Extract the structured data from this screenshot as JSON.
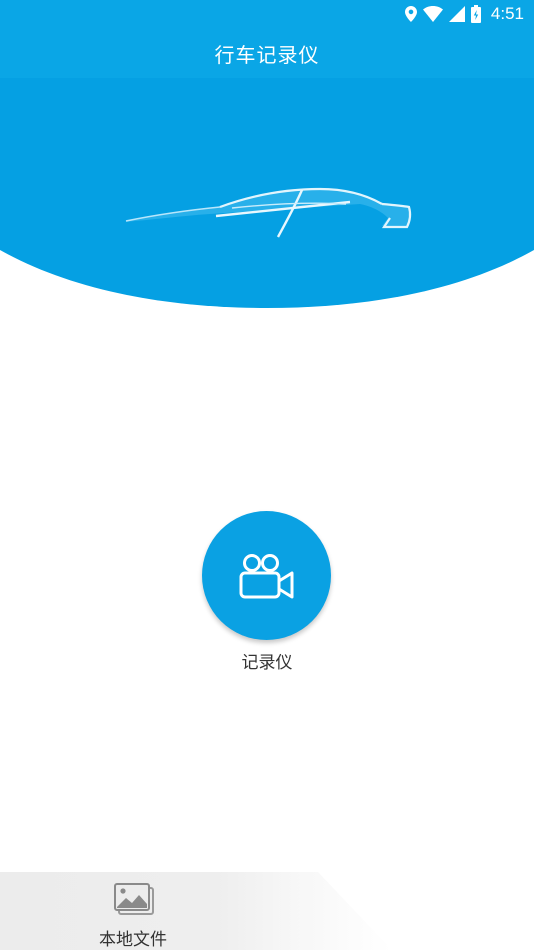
{
  "status_bar": {
    "time": "4:51",
    "icons": [
      "location-icon",
      "wifi-icon",
      "cell-signal-icon",
      "battery-icon"
    ]
  },
  "toolbar": {
    "title": "行车记录仪"
  },
  "header": {
    "image": "car-silhouette-icon"
  },
  "main": {
    "record_button": {
      "icon": "video-camera-icon",
      "label": "记录仪"
    }
  },
  "bottom_nav": {
    "items": [
      {
        "icon": "image-gallery-icon",
        "label": "本地文件"
      }
    ]
  },
  "colors": {
    "primary": "#0aa6e6",
    "button": "#0aa1e3",
    "text": "#333333",
    "nav_background": "#ececec"
  }
}
